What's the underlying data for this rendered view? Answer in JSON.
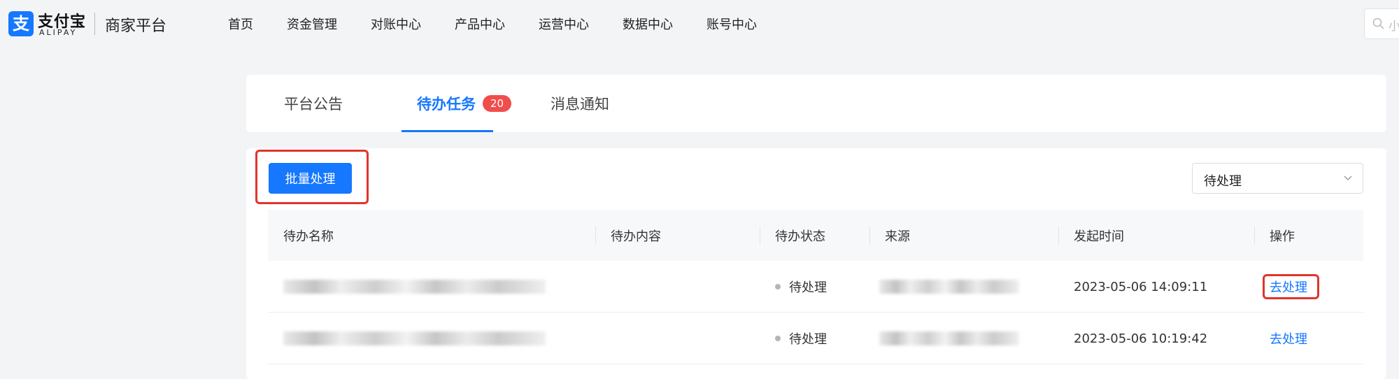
{
  "app": {
    "logo_cn": "支付宝",
    "logo_en": "ALIPAY",
    "logo_glyph": "支",
    "platform_title": "商家平台"
  },
  "nav": {
    "items": [
      {
        "label": "首页"
      },
      {
        "label": "资金管理"
      },
      {
        "label": "对账中心"
      },
      {
        "label": "产品中心"
      },
      {
        "label": "运营中心"
      },
      {
        "label": "数据中心"
      },
      {
        "label": "账号中心"
      }
    ]
  },
  "search": {
    "placeholder": "小",
    "icon": "search-icon"
  },
  "tabs": {
    "items": [
      {
        "label": "平台公告"
      },
      {
        "label": "待办任务",
        "badge": "20",
        "active": true
      },
      {
        "label": "消息通知"
      }
    ]
  },
  "toolbar": {
    "batch_label": "批量处理",
    "status_filter_value": "待处理"
  },
  "table": {
    "columns": [
      "待办名称",
      "待办内容",
      "待办状态",
      "来源",
      "发起时间",
      "操作"
    ],
    "rows": [
      {
        "name": "",
        "content": "",
        "status": "待处理",
        "source": "",
        "time": "2023-05-06 14:09:11",
        "action": "去处理"
      },
      {
        "name": "",
        "content": "",
        "status": "待处理",
        "source": "",
        "time": "2023-05-06 10:19:42",
        "action": "去处理"
      }
    ]
  },
  "colors": {
    "accent": "#1677ff",
    "badge": "#f04d4d",
    "highlight": "#e0342c"
  }
}
